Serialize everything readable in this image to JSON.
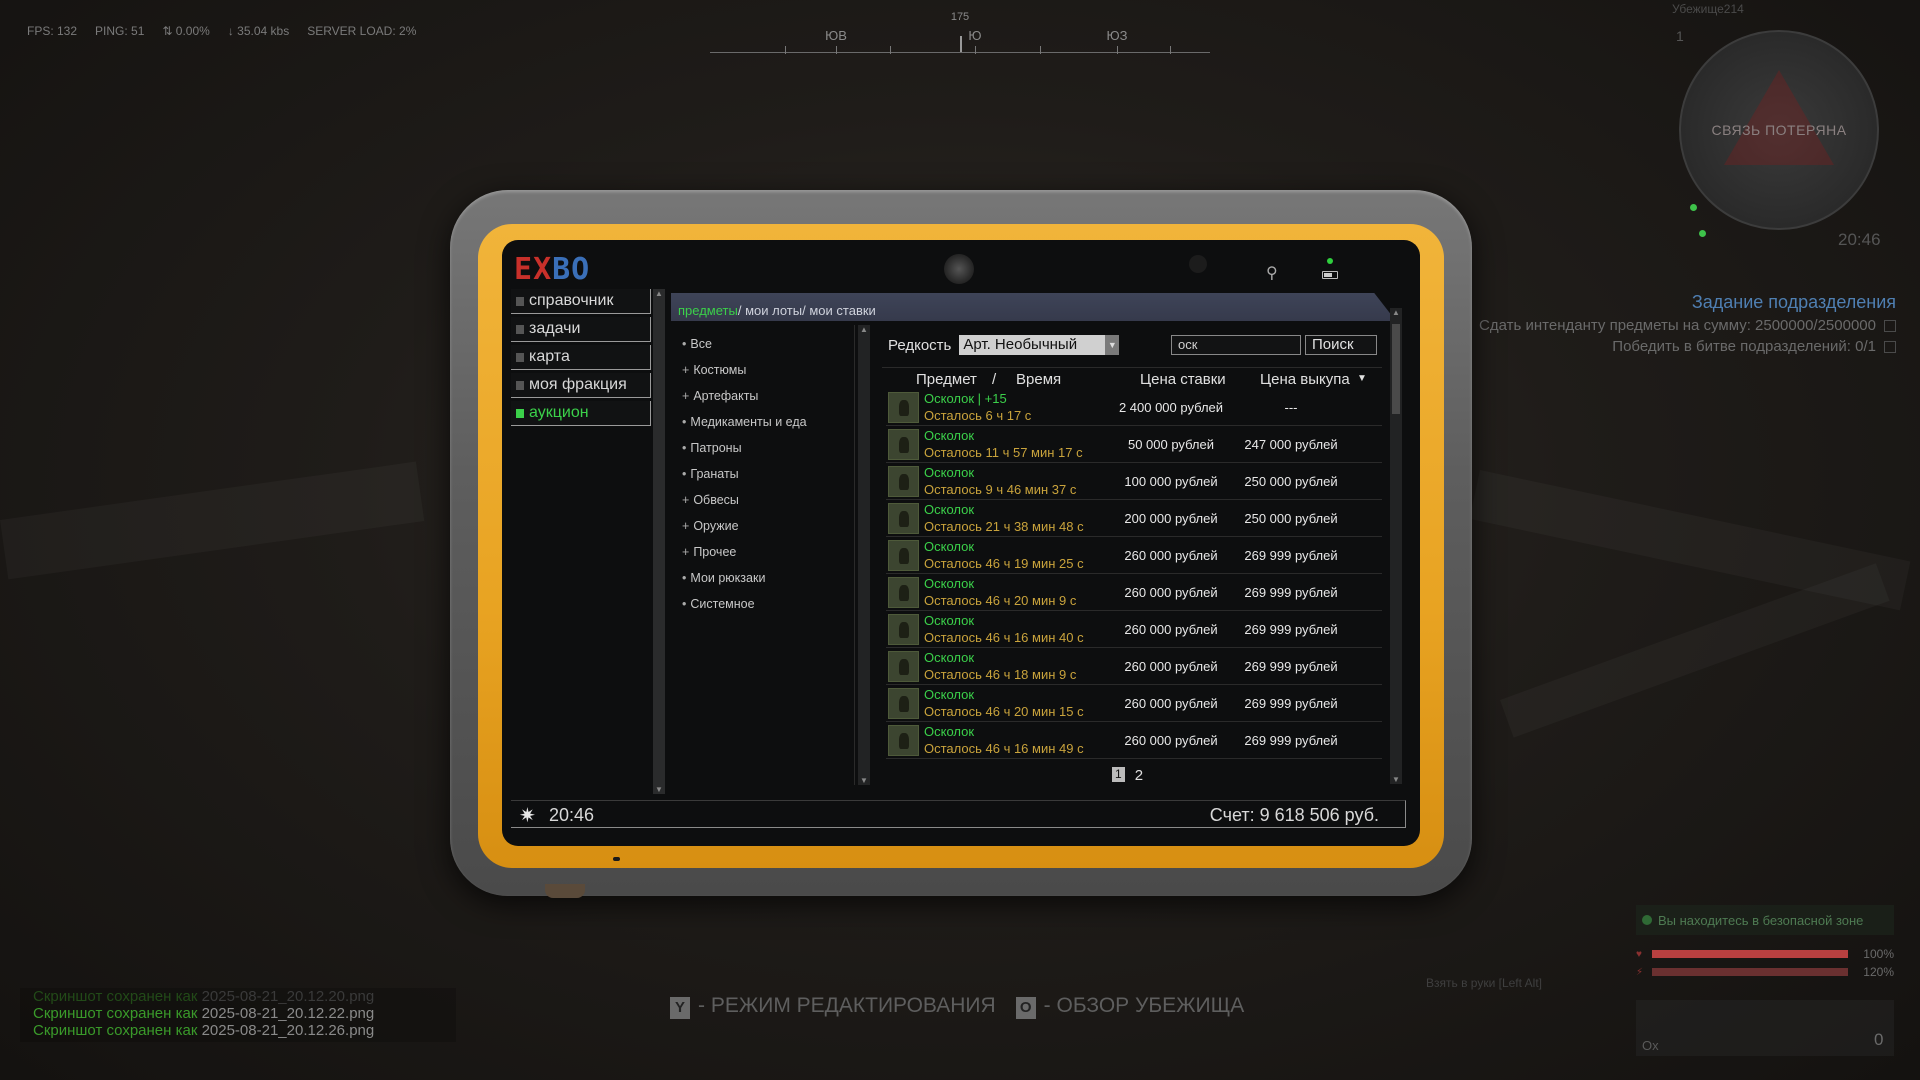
{
  "hud": {
    "fps": "FPS: 132",
    "ping": "PING: 51",
    "loss": "0.00%",
    "speed": "↓ 35.04 kbs",
    "server_load": "SERVER LOAD: 2%"
  },
  "compass": {
    "heading": "175",
    "left_label": "ЮВ",
    "center_label": "Ю",
    "right_label": "ЮЗ"
  },
  "minimap": {
    "shelter_name": "Убежище214",
    "floor": "1",
    "status": "СВЯЗЬ ПОТЕРЯНА",
    "time": "20:46"
  },
  "mission": {
    "title": "Задание подразделения",
    "line1": "Сдать интенданту предметы на сумму: 2500000/2500000",
    "line2": "Победить в битве подразделений: 0/1"
  },
  "status_right": {
    "safe_zone": "Вы находитесь в безопасной зоне",
    "take_hint": "Взять в руки [Left Alt]",
    "health": "100%",
    "stamina": "120%",
    "ox": "Ox",
    "ammo": "0",
    "colors": {
      "health": "#b84040",
      "stamina": "#6a3030"
    }
  },
  "hints": {
    "edit_key": "Y",
    "edit_label": "- РЕЖИМ РЕДАКТИРОВАНИЯ",
    "shelter_key": "O",
    "shelter_label": "- ОБЗОР УБЕЖИЩА"
  },
  "log": [
    {
      "prefix": "Скриншот сохранен как",
      "file": "2025-08-21_20.12.20.png",
      "faint": true
    },
    {
      "prefix": "Скриншот сохранен как",
      "file": "2025-08-21_20.12.22.png",
      "faint": false
    },
    {
      "prefix": "Скриншот сохранен как",
      "file": "2025-08-21_20.12.26.png",
      "faint": false
    }
  ],
  "tablet": {
    "logo": {
      "e": "E",
      "x": "X",
      "bo": "BO"
    },
    "nav": [
      {
        "label": "справочник",
        "active": false
      },
      {
        "label": "задачи",
        "active": false
      },
      {
        "label": "карта",
        "active": false
      },
      {
        "label": "моя фракция",
        "active": false
      },
      {
        "label": "аукцион",
        "active": true
      }
    ],
    "breadcrumbs": {
      "current": "предметы",
      "sep": "/",
      "lots": "мои лоты",
      "bids": "мои ставки"
    },
    "categories": [
      {
        "bullet": "•",
        "label": "Все"
      },
      {
        "bullet": "+",
        "label": "Костюмы"
      },
      {
        "bullet": "+",
        "label": "Артефакты"
      },
      {
        "bullet": "•",
        "label": "Медикаменты и еда"
      },
      {
        "bullet": "•",
        "label": "Патроны"
      },
      {
        "bullet": "•",
        "label": "Гранаты"
      },
      {
        "bullet": "+",
        "label": "Обвесы"
      },
      {
        "bullet": "+",
        "label": "Оружие"
      },
      {
        "bullet": "+",
        "label": "Прочее"
      },
      {
        "bullet": "•",
        "label": "Мои рюкзаки"
      },
      {
        "bullet": "•",
        "label": "Системное"
      }
    ],
    "filter": {
      "rarity_label": "Редкость",
      "rarity_value": "Арт. Необычный",
      "search_value": "оск",
      "search_button": "Поиск"
    },
    "table": {
      "col_item": "Предмет",
      "col_sep": "/",
      "col_time": "Время",
      "col_bid": "Цена ставки",
      "col_buy": "Цена выкупа",
      "sort_arrow": "▼",
      "rows": [
        {
          "name": "Осколок | +15",
          "time": "Осталось 6 ч 17 с",
          "bid": "2 400 000 рублей",
          "buy": "---"
        },
        {
          "name": "Осколок",
          "time": "Осталось 11 ч 57 мин 17 с",
          "bid": "50 000 рублей",
          "buy": "247 000 рублей"
        },
        {
          "name": "Осколок",
          "time": "Осталось 9 ч 46 мин 37 с",
          "bid": "100 000 рублей",
          "buy": "250 000 рублей"
        },
        {
          "name": "Осколок",
          "time": "Осталось 21 ч 38 мин 48 с",
          "bid": "200 000 рублей",
          "buy": "250 000 рублей"
        },
        {
          "name": "Осколок",
          "time": "Осталось 46 ч 19 мин 25 с",
          "bid": "260 000 рублей",
          "buy": "269 999 рублей"
        },
        {
          "name": "Осколок",
          "time": "Осталось 46 ч 20 мин 9 с",
          "bid": "260 000 рублей",
          "buy": "269 999 рублей"
        },
        {
          "name": "Осколок",
          "time": "Осталось 46 ч 16 мин 40 с",
          "bid": "260 000 рублей",
          "buy": "269 999 рублей"
        },
        {
          "name": "Осколок",
          "time": "Осталось 46 ч 18 мин 9 с",
          "bid": "260 000 рублей",
          "buy": "269 999 рублей"
        },
        {
          "name": "Осколок",
          "time": "Осталось 46 ч 20 мин 15 с",
          "bid": "260 000 рублей",
          "buy": "269 999 рублей"
        },
        {
          "name": "Осколок",
          "time": "Осталось 46 ч 16 мин 49 с",
          "bid": "260 000 рублей",
          "buy": "269 999 рублей"
        }
      ]
    },
    "pagination": {
      "pages": [
        "1",
        "2"
      ],
      "current": "1"
    },
    "status": {
      "time": "20:46",
      "balance": "Счет: 9 618 506 руб."
    }
  },
  "colors": {
    "accent_green": "#3bd04a",
    "time_yellow": "#c9a33c",
    "tablet_orange": "#e8a322",
    "logo_red": "#c8302a",
    "logo_blue": "#3a6fb8",
    "mission_blue": "#4f7fb2"
  }
}
